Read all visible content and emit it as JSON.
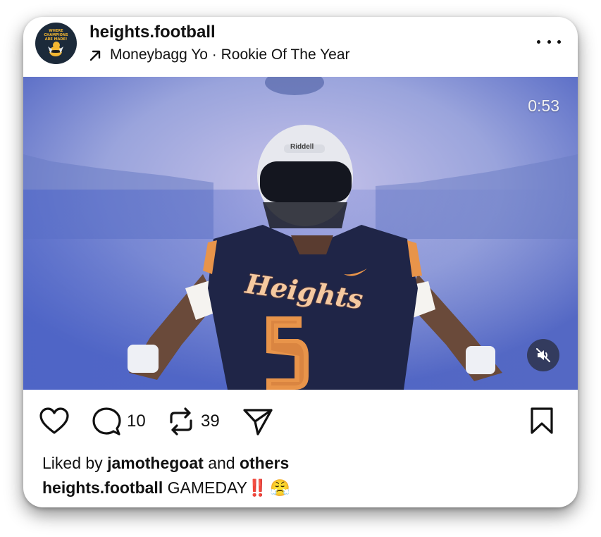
{
  "post": {
    "username": "heights.football",
    "avatar_text": "WHERE\nCHAMPIONS\nARE MADE!",
    "audio_label": "Moneybagg Yo · Rookie Of The Year",
    "more_icon": "ellipsis-icon",
    "video": {
      "duration": "0:53",
      "mute_icon": "speaker-muted-icon",
      "jersey_text": "Heights",
      "jersey_number": "5",
      "helmet_brand": "Riddell"
    },
    "actions": {
      "comments_count": "10",
      "reposts_count": "39"
    },
    "likes": {
      "prefix": "Liked by",
      "user": "jamothegoat",
      "conjunction": "and",
      "others": "others"
    },
    "caption": {
      "username": "heights.football",
      "text": "GAMEDAY",
      "emphasis": "‼️",
      "emoji": "😤"
    }
  },
  "colors": {
    "text": "#111111",
    "jersey_orange": "#e8944a",
    "jersey_navy": "#1f2547",
    "fog_blue": "#8d9ad8",
    "alert_red": "#e53935"
  }
}
